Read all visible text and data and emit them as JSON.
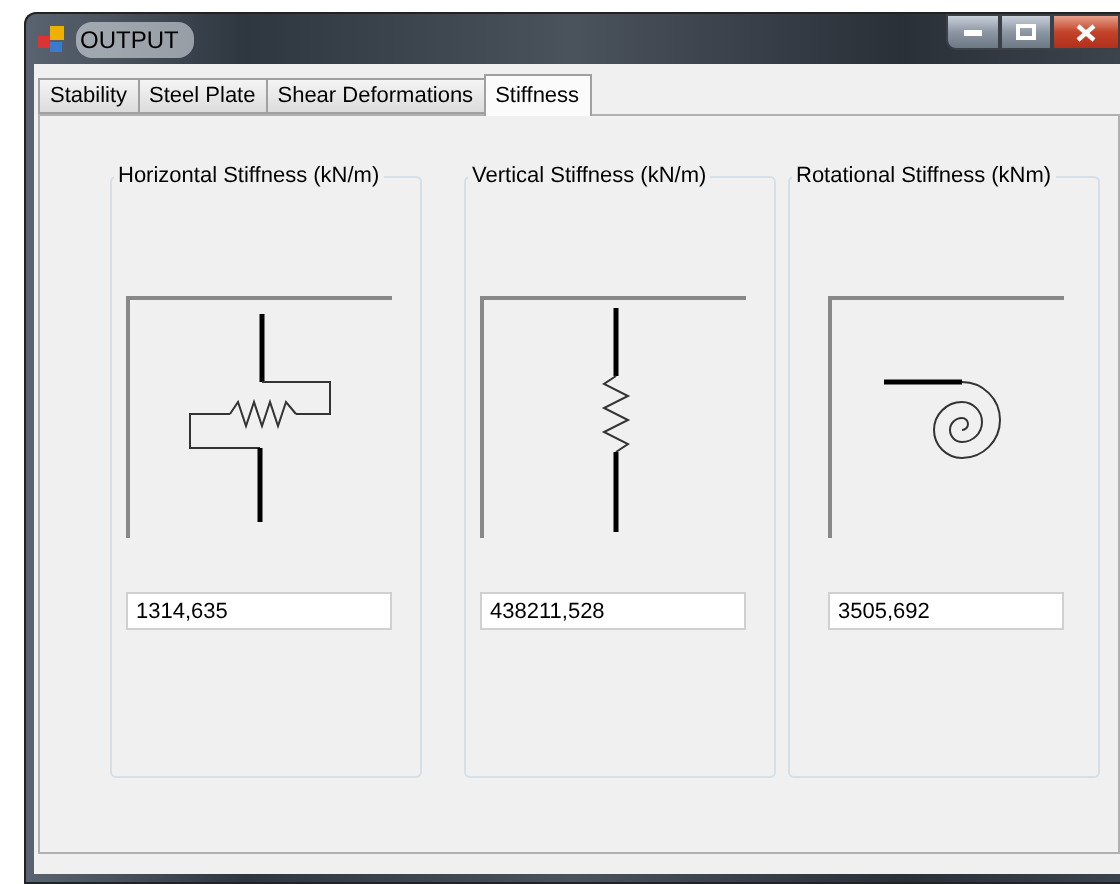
{
  "window": {
    "title": "OUTPUT"
  },
  "tabs": [
    {
      "label": "Stability",
      "selected": false
    },
    {
      "label": "Steel Plate",
      "selected": false
    },
    {
      "label": "Shear Deformations",
      "selected": false
    },
    {
      "label": "Stiffness",
      "selected": true
    }
  ],
  "groups": [
    {
      "title": "Horizontal Stiffness (kN/m)",
      "kind": "horizontal",
      "value": "1314,635"
    },
    {
      "title": "Vertical Stiffness (kN/m)",
      "kind": "vertical",
      "value": "438211,528"
    },
    {
      "title": "Rotational Stiffness (kNm)",
      "kind": "rotational",
      "value": "3505,692"
    }
  ]
}
